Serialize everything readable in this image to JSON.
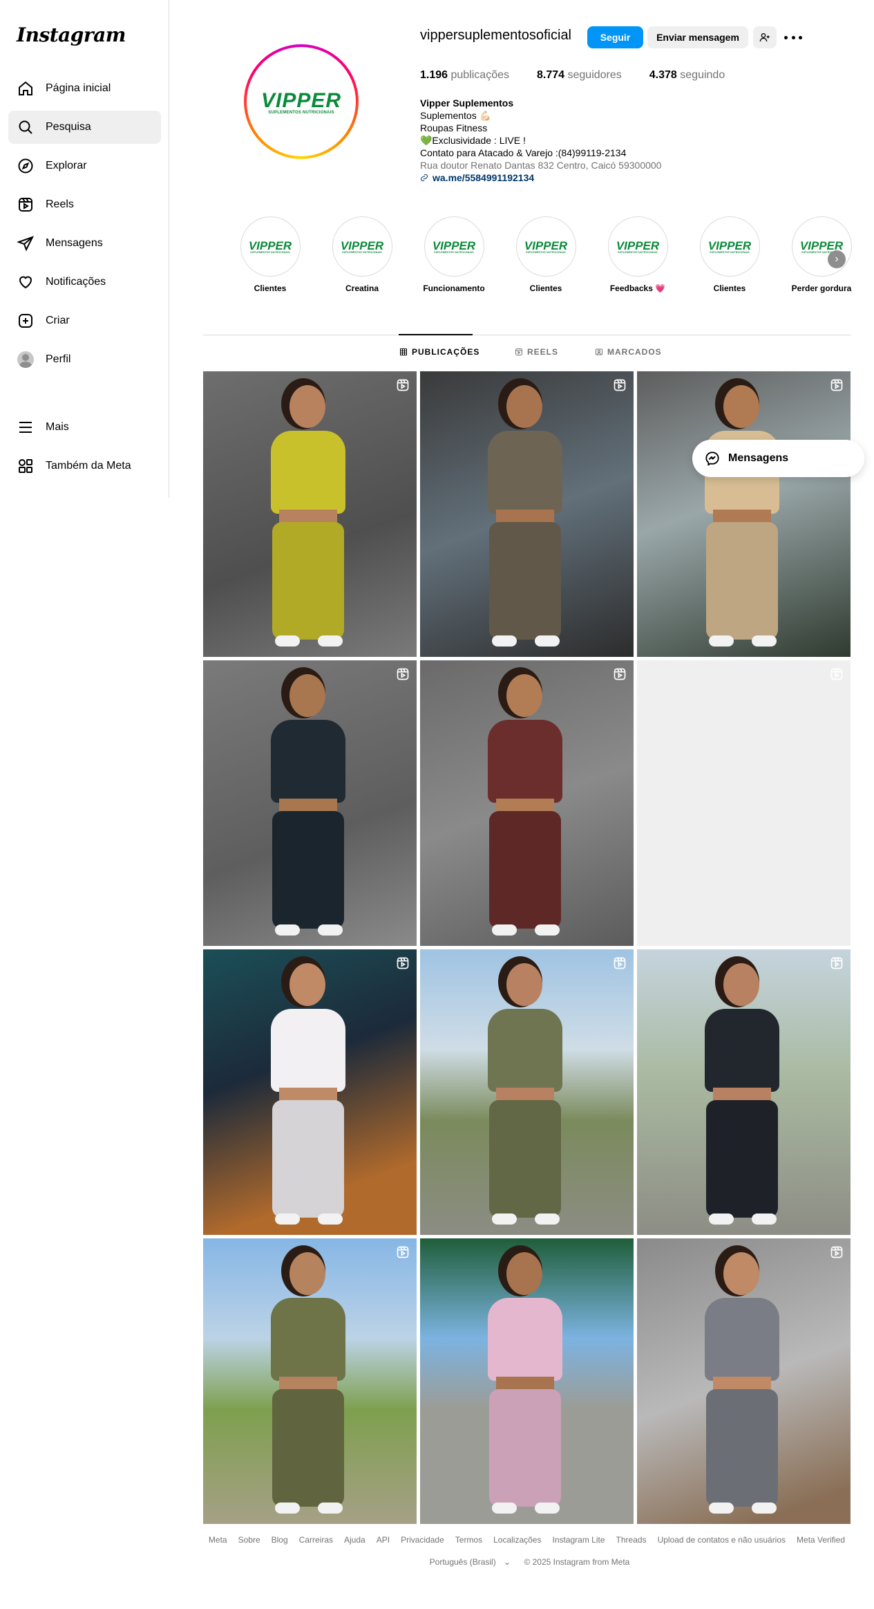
{
  "sidebar": {
    "logo": "Instagram",
    "items": [
      {
        "label": "Página inicial",
        "icon": "home-icon"
      },
      {
        "label": "Pesquisa",
        "icon": "search-icon"
      },
      {
        "label": "Explorar",
        "icon": "compass-icon"
      },
      {
        "label": "Reels",
        "icon": "reels-icon"
      },
      {
        "label": "Mensagens",
        "icon": "send-icon"
      },
      {
        "label": "Notificações",
        "icon": "heart-icon"
      },
      {
        "label": "Criar",
        "icon": "plus-square-icon"
      },
      {
        "label": "Perfil",
        "icon": "avatar"
      }
    ],
    "bottom": [
      {
        "label": "Mais",
        "icon": "menu-icon"
      },
      {
        "label": "Também da Meta",
        "icon": "meta-apps-icon"
      }
    ]
  },
  "profile": {
    "username": "vippersuplementosoficial",
    "follow_label": "Seguir",
    "message_label": "Enviar mensagem",
    "stats": {
      "posts_count": "1.196",
      "posts_label": "publicações",
      "followers_count": "8.774",
      "followers_label": "seguidores",
      "following_count": "4.378",
      "following_label": "seguindo"
    },
    "bio": {
      "name": "Vipper Suplementos",
      "lines": [
        "Suplementos 💪🏻",
        "Roupas Fitness",
        "💚Exclusividade : LIVE !",
        "Contato para Atacado & Varejo :(84)99119-2134"
      ],
      "address": "Rua doutor Renato Dantas 832 Centro, Caicó 59300000",
      "link": "wa.me/5584991192134"
    },
    "logo_text": "VIPPER",
    "logo_sub": "SUPLEMENTOS NUTRICIONAIS"
  },
  "highlights": [
    {
      "label": "Clientes"
    },
    {
      "label": "Creatina"
    },
    {
      "label": "Funcionamento"
    },
    {
      "label": "Clientes"
    },
    {
      "label": "Feedbacks 💗"
    },
    {
      "label": "Clientes"
    },
    {
      "label": "Perder gordura"
    }
  ],
  "tabs": [
    {
      "label": "PUBLICAÇÕES",
      "icon": "grid-icon"
    },
    {
      "label": "REELS",
      "icon": "reels-icon"
    },
    {
      "label": "MARCADOS",
      "icon": "tagged-icon"
    }
  ],
  "floating": {
    "messages_label": "Mensagens"
  },
  "footer": {
    "links": [
      "Meta",
      "Sobre",
      "Blog",
      "Carreiras",
      "Ajuda",
      "API",
      "Privacidade",
      "Termos",
      "Localizações",
      "Instagram Lite",
      "Threads",
      "Upload de contatos e não usuários",
      "Meta Verified"
    ],
    "language": "Português (Brasil)",
    "copyright": "© 2025 Instagram from Meta"
  },
  "colors": {
    "accent_blue": "#0095f6",
    "brand_green": "#0a8a3a",
    "muted_text": "#737373"
  }
}
